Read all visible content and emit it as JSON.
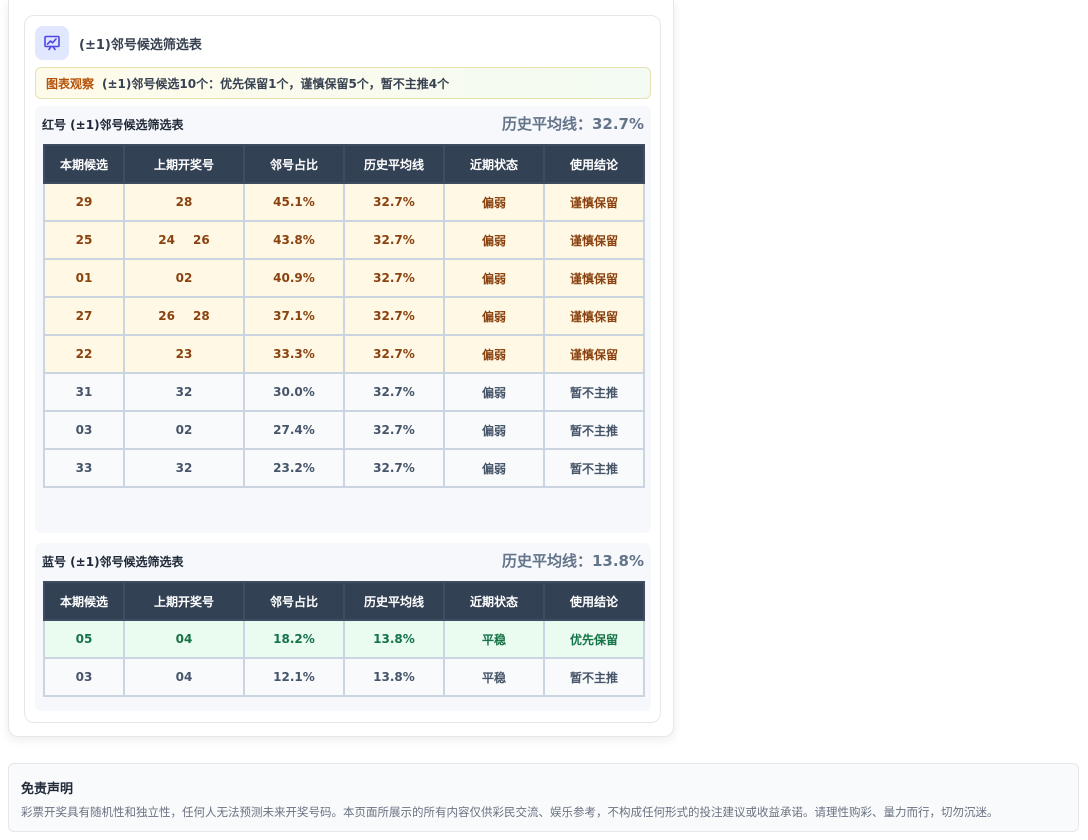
{
  "card": {
    "icon": "presentation-chart-icon",
    "title": "(±1)邻号候选筛选表",
    "observation_tag": "图表观察",
    "observation_text": "(±1)邻号候选10个：优先保留1个，谨慎保留5个，暂不主推4个"
  },
  "red_table": {
    "title": "红号 (±1)邻号候选筛选表",
    "average_label": "历史平均线：32.7%",
    "headers": [
      "本期候选",
      "上期开奖号",
      "邻号占比",
      "历史平均线",
      "近期状态",
      "使用结论"
    ],
    "rows": [
      {
        "candidate": "29",
        "prev": [
          "28"
        ],
        "ratio": "45.1%",
        "avg": "32.7%",
        "status": "偏弱",
        "conclusion": "谨慎保留",
        "level": "caution"
      },
      {
        "candidate": "25",
        "prev": [
          "24",
          "26"
        ],
        "ratio": "43.8%",
        "avg": "32.7%",
        "status": "偏弱",
        "conclusion": "谨慎保留",
        "level": "caution"
      },
      {
        "candidate": "01",
        "prev": [
          "02"
        ],
        "ratio": "40.9%",
        "avg": "32.7%",
        "status": "偏弱",
        "conclusion": "谨慎保留",
        "level": "caution"
      },
      {
        "candidate": "27",
        "prev": [
          "26",
          "28"
        ],
        "ratio": "37.1%",
        "avg": "32.7%",
        "status": "偏弱",
        "conclusion": "谨慎保留",
        "level": "caution"
      },
      {
        "candidate": "22",
        "prev": [
          "23"
        ],
        "ratio": "33.3%",
        "avg": "32.7%",
        "status": "偏弱",
        "conclusion": "谨慎保留",
        "level": "caution"
      },
      {
        "candidate": "31",
        "prev": [
          "32"
        ],
        "ratio": "30.0%",
        "avg": "32.7%",
        "status": "偏弱",
        "conclusion": "暂不主推",
        "level": "normal"
      },
      {
        "candidate": "03",
        "prev": [
          "02"
        ],
        "ratio": "27.4%",
        "avg": "32.7%",
        "status": "偏弱",
        "conclusion": "暂不主推",
        "level": "normal"
      },
      {
        "candidate": "33",
        "prev": [
          "32"
        ],
        "ratio": "23.2%",
        "avg": "32.7%",
        "status": "偏弱",
        "conclusion": "暂不主推",
        "level": "normal"
      }
    ]
  },
  "blue_table": {
    "title": "蓝号 (±1)邻号候选筛选表",
    "average_label": "历史平均线：13.8%",
    "headers": [
      "本期候选",
      "上期开奖号",
      "邻号占比",
      "历史平均线",
      "近期状态",
      "使用结论"
    ],
    "rows": [
      {
        "candidate": "05",
        "prev": [
          "04"
        ],
        "ratio": "18.2%",
        "avg": "13.8%",
        "status": "平稳",
        "conclusion": "优先保留",
        "level": "priority"
      },
      {
        "candidate": "03",
        "prev": [
          "04"
        ],
        "ratio": "12.1%",
        "avg": "13.8%",
        "status": "平稳",
        "conclusion": "暂不主推",
        "level": "normal"
      }
    ]
  },
  "disclaimer": {
    "title": "免责声明",
    "text": "彩票开奖具有随机性和独立性，任何人无法预测未来开奖号码。本页面所展示的所有内容仅供彩民交流、娱乐参考，不构成任何形式的投注建议或收益承诺。请理性购彩、量力而行，切勿沉迷。"
  },
  "colors": {
    "header_bg": "#334155",
    "caution_bg": "#fef8e4",
    "caution_text": "#8a4210",
    "priority_bg": "#eafbf0",
    "priority_text": "#157347",
    "accent_icon": "#4f46e5"
  }
}
